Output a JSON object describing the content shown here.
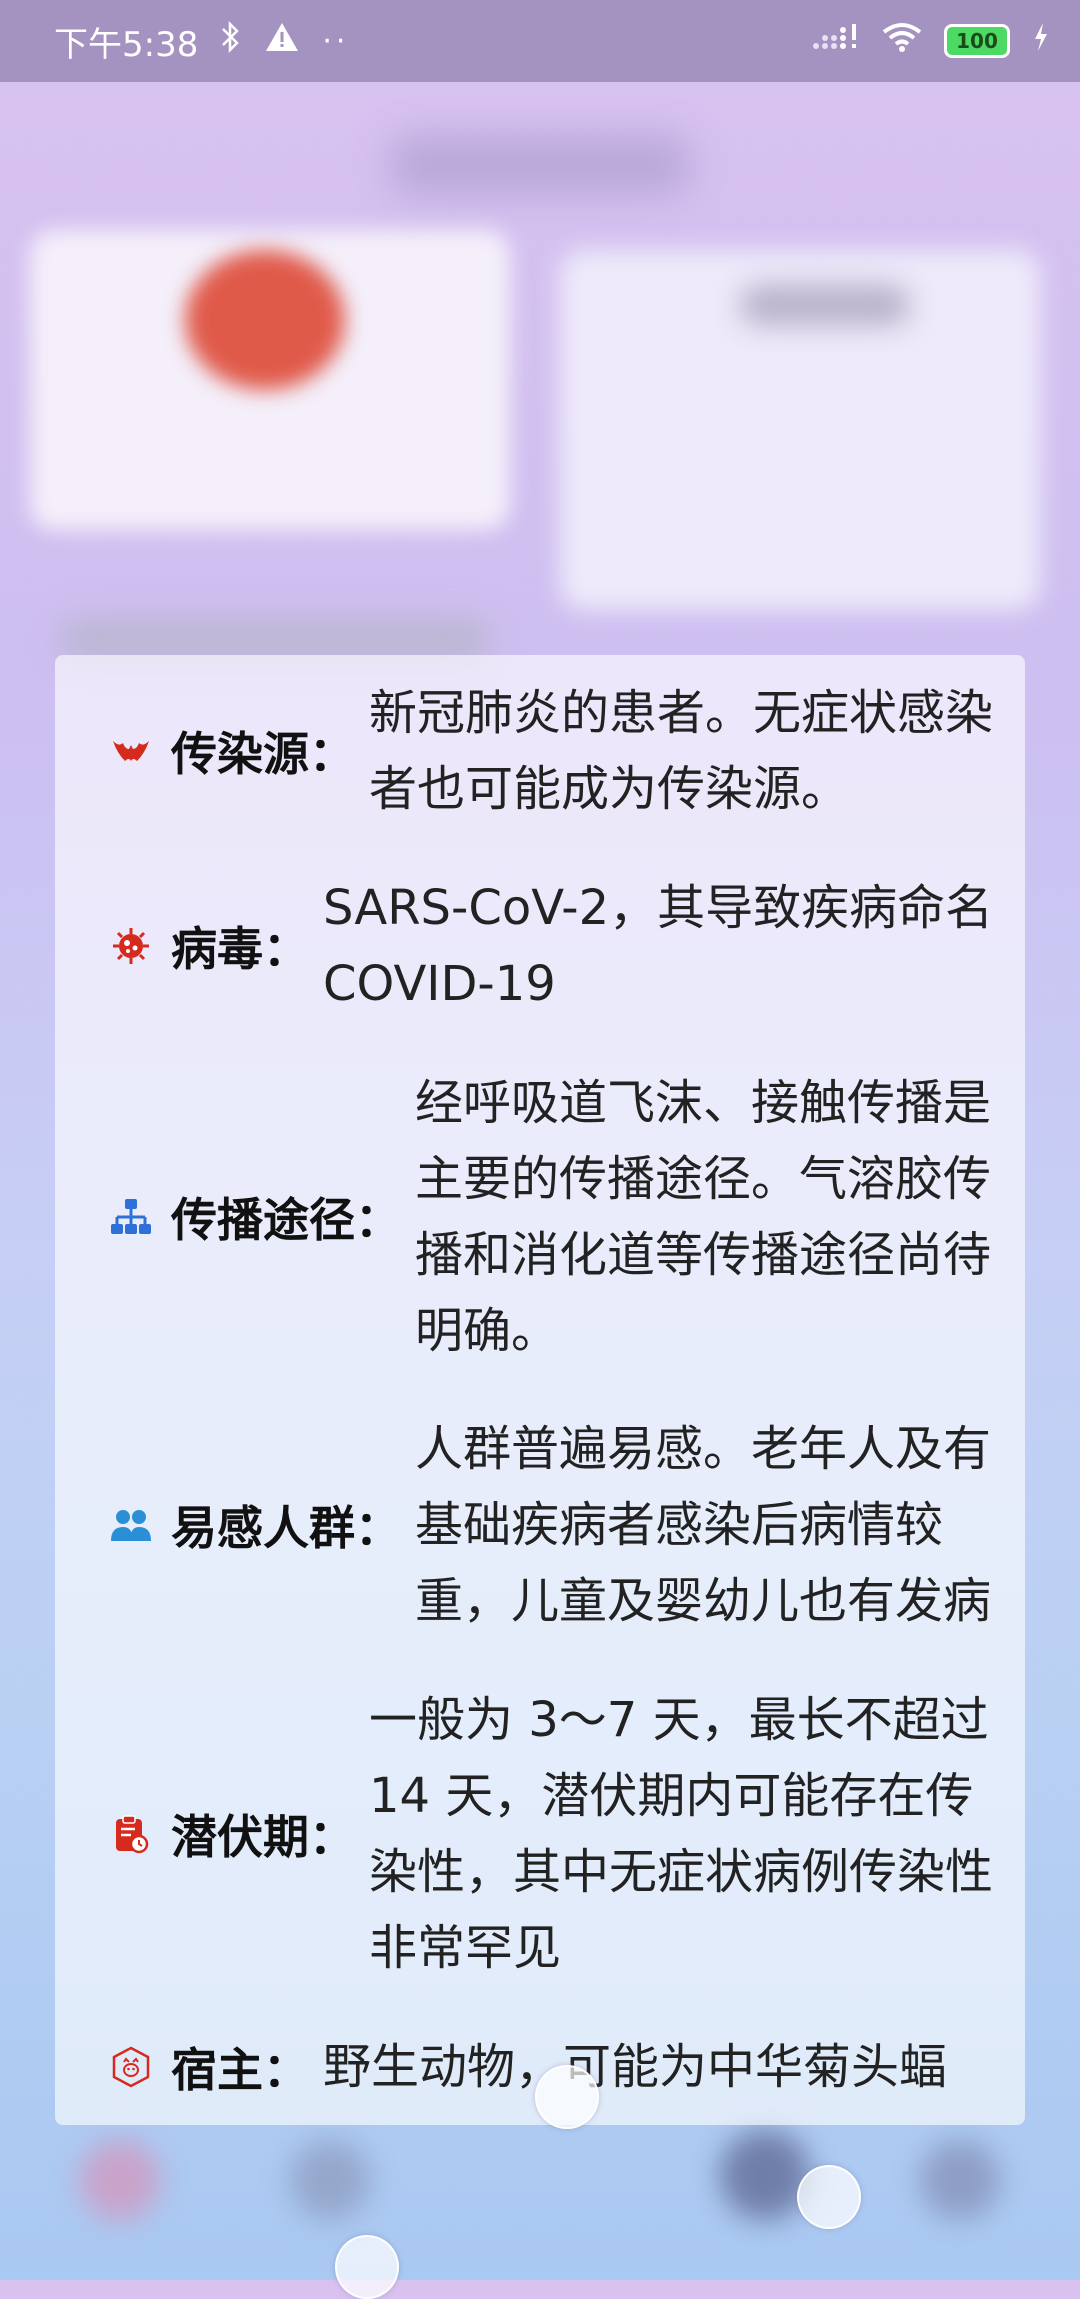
{
  "status_bar": {
    "time": "下午5:38",
    "battery": "100",
    "overflow": "··"
  },
  "card": {
    "items": [
      {
        "label": "传染源：",
        "text": "新冠肺炎的患者。无症状感染者也可能成为传染源。",
        "icon": "bat-icon",
        "icon_color": "#d62a1e"
      },
      {
        "label": "病毒：",
        "text": "SARS-CoV-2，其导致疾病命名 COVID-19",
        "icon": "virus-icon",
        "icon_color": "#d62a1e"
      },
      {
        "label": "传播途径：",
        "text": "经呼吸道飞沫、接触传播是主要的传播途径。气溶胶传播和消化道等传播途径尚待明确。",
        "icon": "network-icon",
        "icon_color": "#2f6fd8"
      },
      {
        "label": "易感人群：",
        "text": "人群普遍易感。老年人及有基础疾病者感染后病情较重，儿童及婴幼儿也有发病",
        "icon": "people-icon",
        "icon_color": "#2b8fd8"
      },
      {
        "label": "潜伏期：",
        "text": "一般为 3～7 天，最长不超过 14 天，潜伏期内可能存在传染性，其中无症状病例传染性非常罕见",
        "icon": "clipboard-clock-icon",
        "icon_color": "#d62a1e"
      },
      {
        "label": "宿主：",
        "text": "野生动物，可能为中华菊头蝠",
        "icon": "host-icon",
        "icon_color": "#d62a1e"
      }
    ]
  }
}
